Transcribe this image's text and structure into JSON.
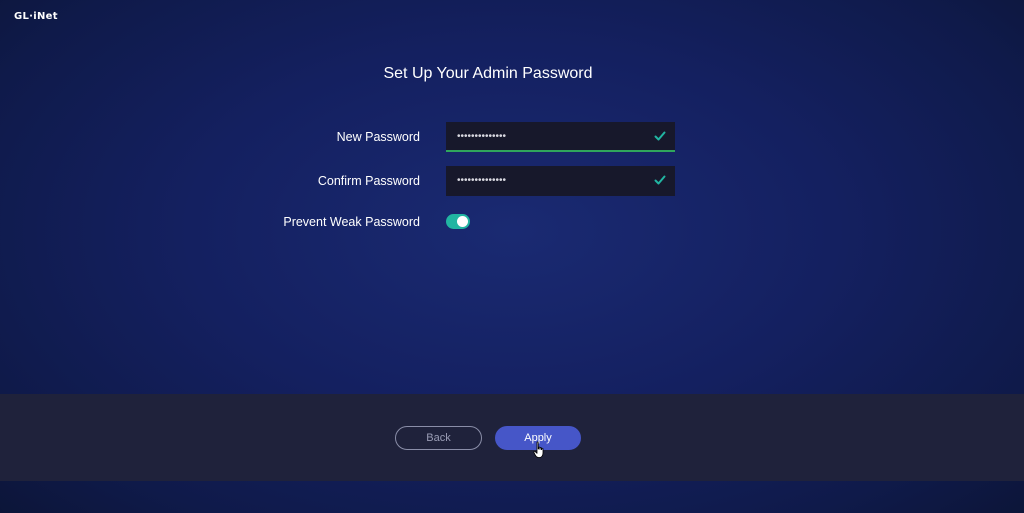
{
  "brand": {
    "logo_text": "GL·iNet"
  },
  "page": {
    "title": "Set Up Your Admin Password"
  },
  "form": {
    "new_password": {
      "label": "New Password",
      "value": "••••••••••••••",
      "valid": true
    },
    "confirm_password": {
      "label": "Confirm Password",
      "value": "••••••••••••••",
      "valid": true
    },
    "prevent_weak": {
      "label": "Prevent Weak Password",
      "enabled": true
    }
  },
  "footer": {
    "back_label": "Back",
    "apply_label": "Apply"
  },
  "colors": {
    "background": "#142060",
    "field_bg": "#17182b",
    "check": "#21b5a2",
    "active_underline": "#2fa65c",
    "toggle_on": "#21b5a2",
    "footer_bg": "#1f223b",
    "primary_button": "#4656c8"
  },
  "icons": {
    "valid": "check-icon",
    "cursor": "hand-pointer-icon"
  }
}
